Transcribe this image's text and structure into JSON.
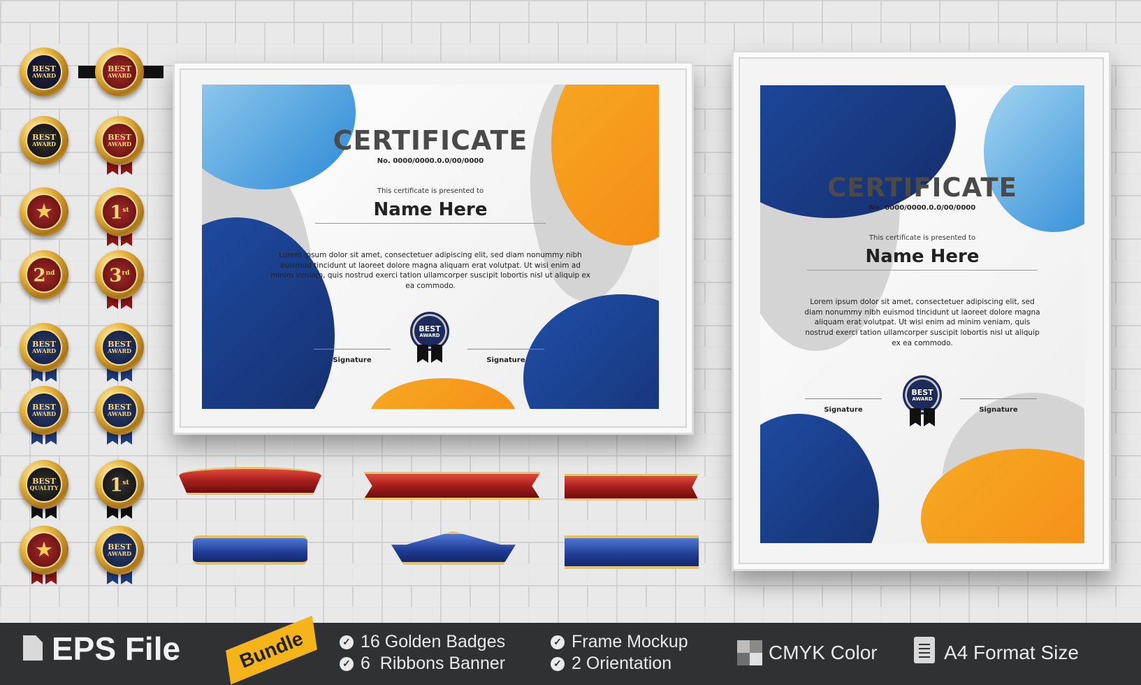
{
  "badges": [
    {
      "kind": "best",
      "line1": "BEST",
      "line2": "AWARD",
      "style": "dark"
    },
    {
      "kind": "best",
      "line1": "BEST",
      "line2": "AWARD",
      "style": "red-gold"
    },
    {
      "kind": "best",
      "line1": "BEST",
      "line2": "AWARD",
      "style": "black"
    },
    {
      "kind": "best",
      "line1": "BEST",
      "line2": "AWARD",
      "style": "red"
    },
    {
      "kind": "star",
      "line1": "★",
      "style": "red"
    },
    {
      "kind": "num",
      "num": "1",
      "suffix": "st",
      "style": "red"
    },
    {
      "kind": "num",
      "num": "2",
      "suffix": "nd",
      "style": "gold"
    },
    {
      "kind": "num",
      "num": "3",
      "suffix": "rd",
      "style": "red"
    },
    {
      "kind": "best",
      "line1": "BEST",
      "line2": "AWARD",
      "style": "navy"
    },
    {
      "kind": "best",
      "line1": "BEST",
      "line2": "AWARD",
      "style": "navy"
    },
    {
      "kind": "best",
      "line1": "BEST",
      "line2": "AWARD",
      "style": "navy"
    },
    {
      "kind": "best",
      "line1": "BEST",
      "line2": "AWARD",
      "style": "navy"
    },
    {
      "kind": "best",
      "line1": "BEST",
      "line2": "QUALITY",
      "style": "black"
    },
    {
      "kind": "num",
      "num": "1",
      "suffix": "st",
      "style": "black"
    },
    {
      "kind": "star",
      "line1": "★",
      "style": "red"
    },
    {
      "kind": "best",
      "line1": "BEST",
      "line2": "AWARD",
      "style": "navy"
    }
  ],
  "certificate_landscape": {
    "title": "CERTIFICATE",
    "number": "No. 0000/0000.0.0/00/0000",
    "presented": "This certificate is presented to",
    "name": "Name Here",
    "body": "Lorem ipsum dolor sit amet, consectetuer adipiscing elit, sed diam nonummy nibh euismod tincidunt ut laoreet dolore magna aliquam erat volutpat. Ut wisi enim ad minim veniam, quis nostrud exerci tation ullamcorper suscipit lobortis nisl ut aliquip ex ea commodo.",
    "badge_line1": "BEST",
    "badge_line2": "AWARD",
    "signature_left": "Signature",
    "signature_right": "Signature"
  },
  "certificate_portrait": {
    "title": "CERTIFICATE",
    "number": "No. 0000/0000.0.0/00/0000",
    "presented": "This certificate is presented to",
    "name": "Name Here",
    "body": "Lorem ipsum dolor sit amet, consectetuer adipiscing elit, sed diam nonummy nibh euismod tincidunt ut laoreet dolore magna aliquam erat volutpat. Ut wisi enim ad minim veniam, quis nostrud exerci tation ullamcorper suscipit lobortis nisl ut aliquip ex ea commodo.",
    "badge_line1": "BEST",
    "badge_line2": "AWARD",
    "signature_left": "Signature",
    "signature_right": "Signature"
  },
  "footer": {
    "file_label": "EPS File",
    "bundle_label": "Bundle",
    "features": {
      "f1": "16 Golden Badges",
      "f2": "6  Ribbons Banner",
      "f3": "Frame Mockup",
      "f4": "2 Orientation",
      "f5": "CMYK Color",
      "f6": "A4 Format Size"
    }
  },
  "colors": {
    "navy": "#152d6b",
    "light_blue": "#2b89d6",
    "orange": "#f48a14",
    "gold": "#e6b540",
    "footer_bg": "#2f3133",
    "bundle_tag": "#f4b41a"
  }
}
